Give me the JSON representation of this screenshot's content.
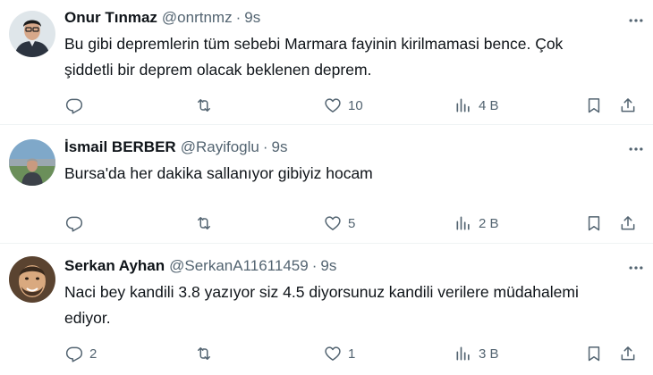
{
  "tweets": [
    {
      "name": "Onur Tınmaz",
      "handle": "@onrtnmz",
      "separator": "·",
      "time": "9s",
      "text_lines": [
        "Bu gibi depremlerin tüm sebebi Marmara fayinin kirilmamasi bence. Çok",
        "şiddetli bir deprem olacak beklenen deprem."
      ],
      "replies": "",
      "retweets": "",
      "likes": "10",
      "views": "4 B"
    },
    {
      "name": "İsmail BERBER",
      "handle": "@Rayifoglu",
      "separator": "·",
      "time": "9s",
      "text_lines": [
        "Bursa'da her dakika sallanıyor gibiyiz hocam"
      ],
      "replies": "",
      "retweets": "",
      "likes": "5",
      "views": "2 B"
    },
    {
      "name": "Serkan Ayhan",
      "handle": "@SerkanA11611459",
      "separator": "·",
      "time": "9s",
      "text_lines": [
        "Naci bey kandili 3.8 yazıyor siz 4.5 diyorsunuz kandili verilere müdahalemi",
        "ediyor."
      ],
      "replies": "2",
      "retweets": "",
      "likes": "1",
      "views": "3 B"
    }
  ],
  "icons": {
    "reply": "reply-icon",
    "retweet": "retweet-icon",
    "like": "heart-icon",
    "views": "views-icon",
    "bookmark": "bookmark-icon",
    "share": "share-icon",
    "more": "more-icon"
  },
  "colors": {
    "text": "#0f1419",
    "secondary": "#536471",
    "divider": "#eff3f4"
  }
}
